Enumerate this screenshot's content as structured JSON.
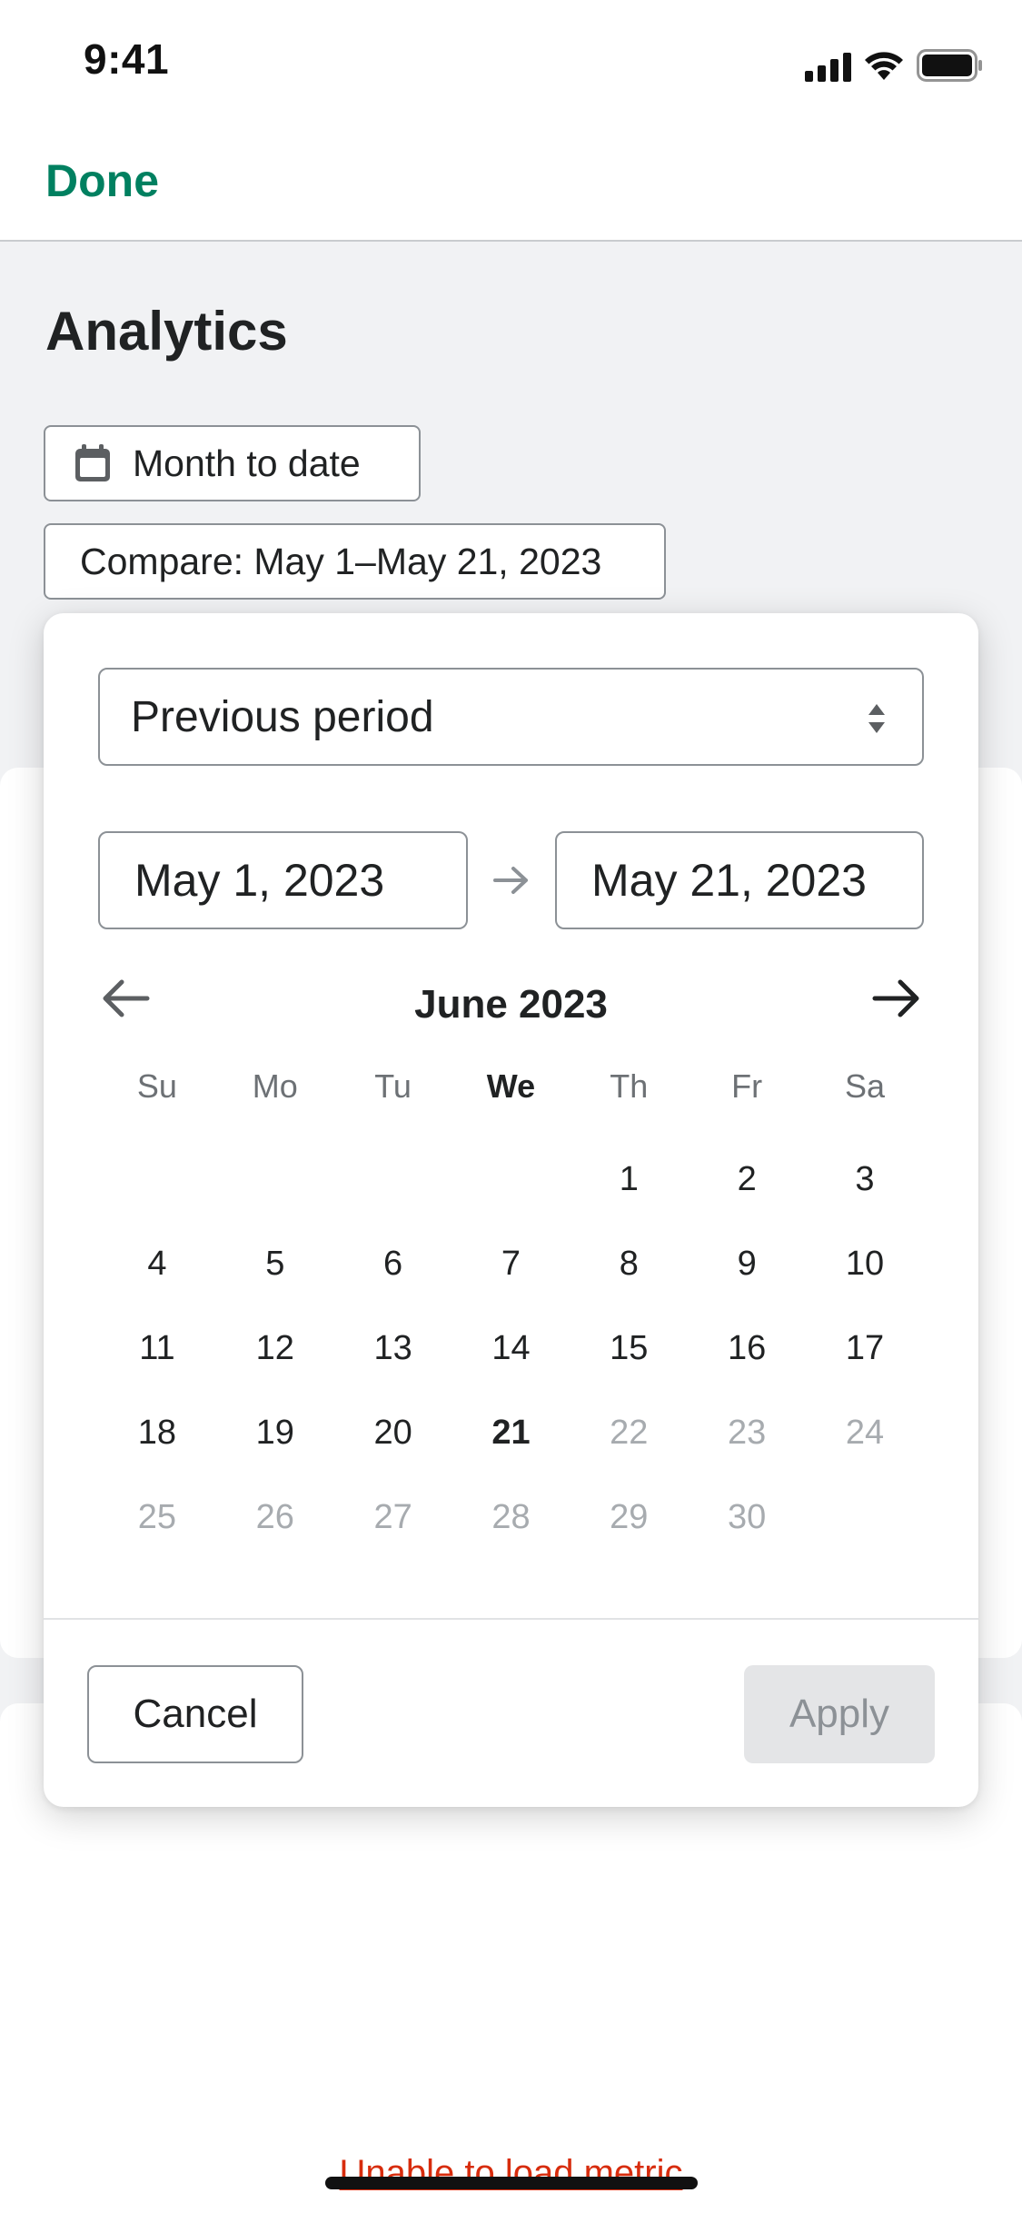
{
  "status_bar": {
    "time": "9:41"
  },
  "nav": {
    "done_label": "Done"
  },
  "page": {
    "title": "Analytics"
  },
  "filters": {
    "date_range_label": "Month to date",
    "compare_label": "Compare: May 1–May 21, 2023"
  },
  "popover": {
    "period_select": "Previous period",
    "start_date": "May 1, 2023",
    "end_date": "May 21, 2023",
    "month_label": "June 2023",
    "weekdays": [
      "Su",
      "Mo",
      "Tu",
      "We",
      "Th",
      "Fr",
      "Sa"
    ],
    "today_weekday_index": 3,
    "weeks": [
      [
        "",
        "",
        "",
        "",
        "1",
        "2",
        "3"
      ],
      [
        "4",
        "5",
        "6",
        "7",
        "8",
        "9",
        "10"
      ],
      [
        "11",
        "12",
        "13",
        "14",
        "15",
        "16",
        "17"
      ],
      [
        "18",
        "19",
        "20",
        "21",
        "22",
        "23",
        "24"
      ],
      [
        "25",
        "26",
        "27",
        "28",
        "29",
        "30",
        ""
      ]
    ],
    "today": "21",
    "last_enabled_day": 21,
    "cancel_label": "Cancel",
    "apply_label": "Apply"
  },
  "error": {
    "message": "Unable to load metric"
  },
  "colors": {
    "accent": "#008060",
    "error": "#d72c0d",
    "disabled_text": "#a7abaf"
  }
}
